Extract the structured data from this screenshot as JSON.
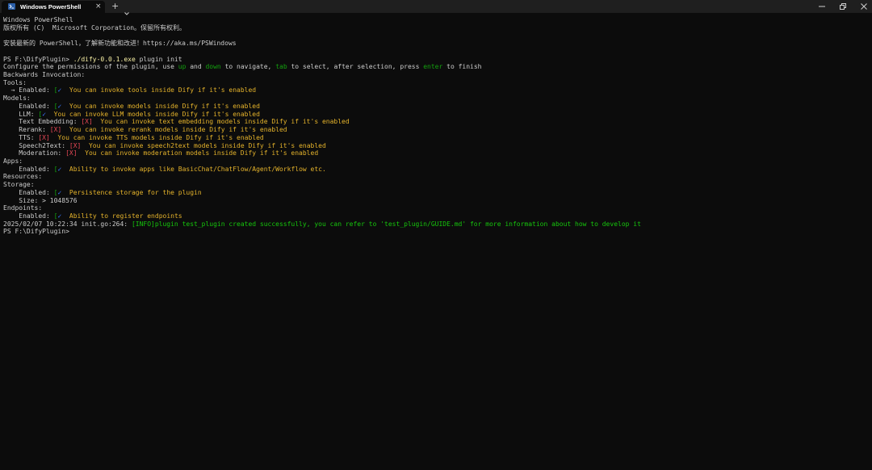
{
  "window": {
    "tab_title": "Windows PowerShell",
    "close_glyph": "×",
    "new_tab_glyph": "+",
    "icons": [
      "powershell-icon",
      "close-icon",
      "plus-icon",
      "chevron-down-icon",
      "minimize-icon",
      "maximize-icon",
      "window-close-icon"
    ]
  },
  "colors": {
    "background": "#0c0c0c",
    "text": "#cccccc",
    "yellow": "#e5b32b",
    "green": "#13a10e",
    "red": "#e74856",
    "check_blue": "#3b78ff"
  },
  "terminal": {
    "header1": "Windows PowerShell",
    "header2": "版权所有 (C)  Microsoft Corporation。保留所有权利。",
    "header3": "安装最新的 PowerShell，了解新功能和改进！https://aka.ms/PSWindows",
    "prompt1": "PS F:\\DifyPlugin> ",
    "command_exe": "./dify-0.0.1.exe",
    "command_args": " plugin init",
    "configure_a": "Configure the permissions of the plugin, use ",
    "key_up": "up",
    "configure_b": " and ",
    "key_down": "down",
    "configure_c": " to navigate, ",
    "key_tab": "tab",
    "configure_d": " to select, after selection, press ",
    "key_enter": "enter",
    "configure_e": " to finish",
    "backwards": "Backwards Invocation:",
    "tools_label": "Tools:",
    "tools_enabled_prefix": "  → Enabled: ",
    "tools_enabled_text": "  You can invoke tools inside Dify if it's enabled",
    "models_label": "Models:",
    "models_enabled_prefix": "    Enabled: ",
    "models_enabled_text": "  You can invoke models inside Dify if it's enabled",
    "llm_prefix": "    LLM: ",
    "llm_text": "  You can invoke LLM models inside Dify if it's enabled",
    "te_prefix": "    Text Embedding: ",
    "te_text": "  You can invoke text embedding models inside Dify if it's enabled",
    "rerank_prefix": "    Rerank: ",
    "rerank_text": "  You can invoke rerank models inside Dify if it's enabled",
    "tts_prefix": "    TTS: ",
    "tts_text": "  You can invoke TTS models inside Dify if it's enabled",
    "s2t_prefix": "    Speech2Text: ",
    "s2t_text": "  You can invoke speech2text models inside Dify if it's enabled",
    "mod_prefix": "    Moderation: ",
    "mod_text": "  You can invoke moderation models inside Dify if it's enabled",
    "apps_label": "Apps:",
    "apps_enabled_prefix": "    Enabled: ",
    "apps_enabled_text": "  Ability to invoke apps like BasicChat/ChatFlow/Agent/Workflow etc.",
    "resources_label": "Resources:",
    "storage_label": "Storage:",
    "storage_enabled_prefix": "    Enabled: ",
    "storage_enabled_text": "  Persistence storage for the plugin",
    "size_line": "    Size: > 1048576",
    "endpoints_label": "Endpoints:",
    "endpoints_enabled_prefix": "    Enabled: ",
    "endpoints_enabled_text": "  Ability to register endpoints",
    "log_prefix": "2025/02/07 10:22:34 init.go:264: ",
    "log_text": "[INFO]plugin test_plugin created successfully, you can refer to 'test_plugin/GUIDE.md' for more information about how to develop it",
    "prompt2": "PS F:\\DifyPlugin>",
    "bracket_open": "[",
    "check": "✓",
    "x_mark": "[X]"
  }
}
